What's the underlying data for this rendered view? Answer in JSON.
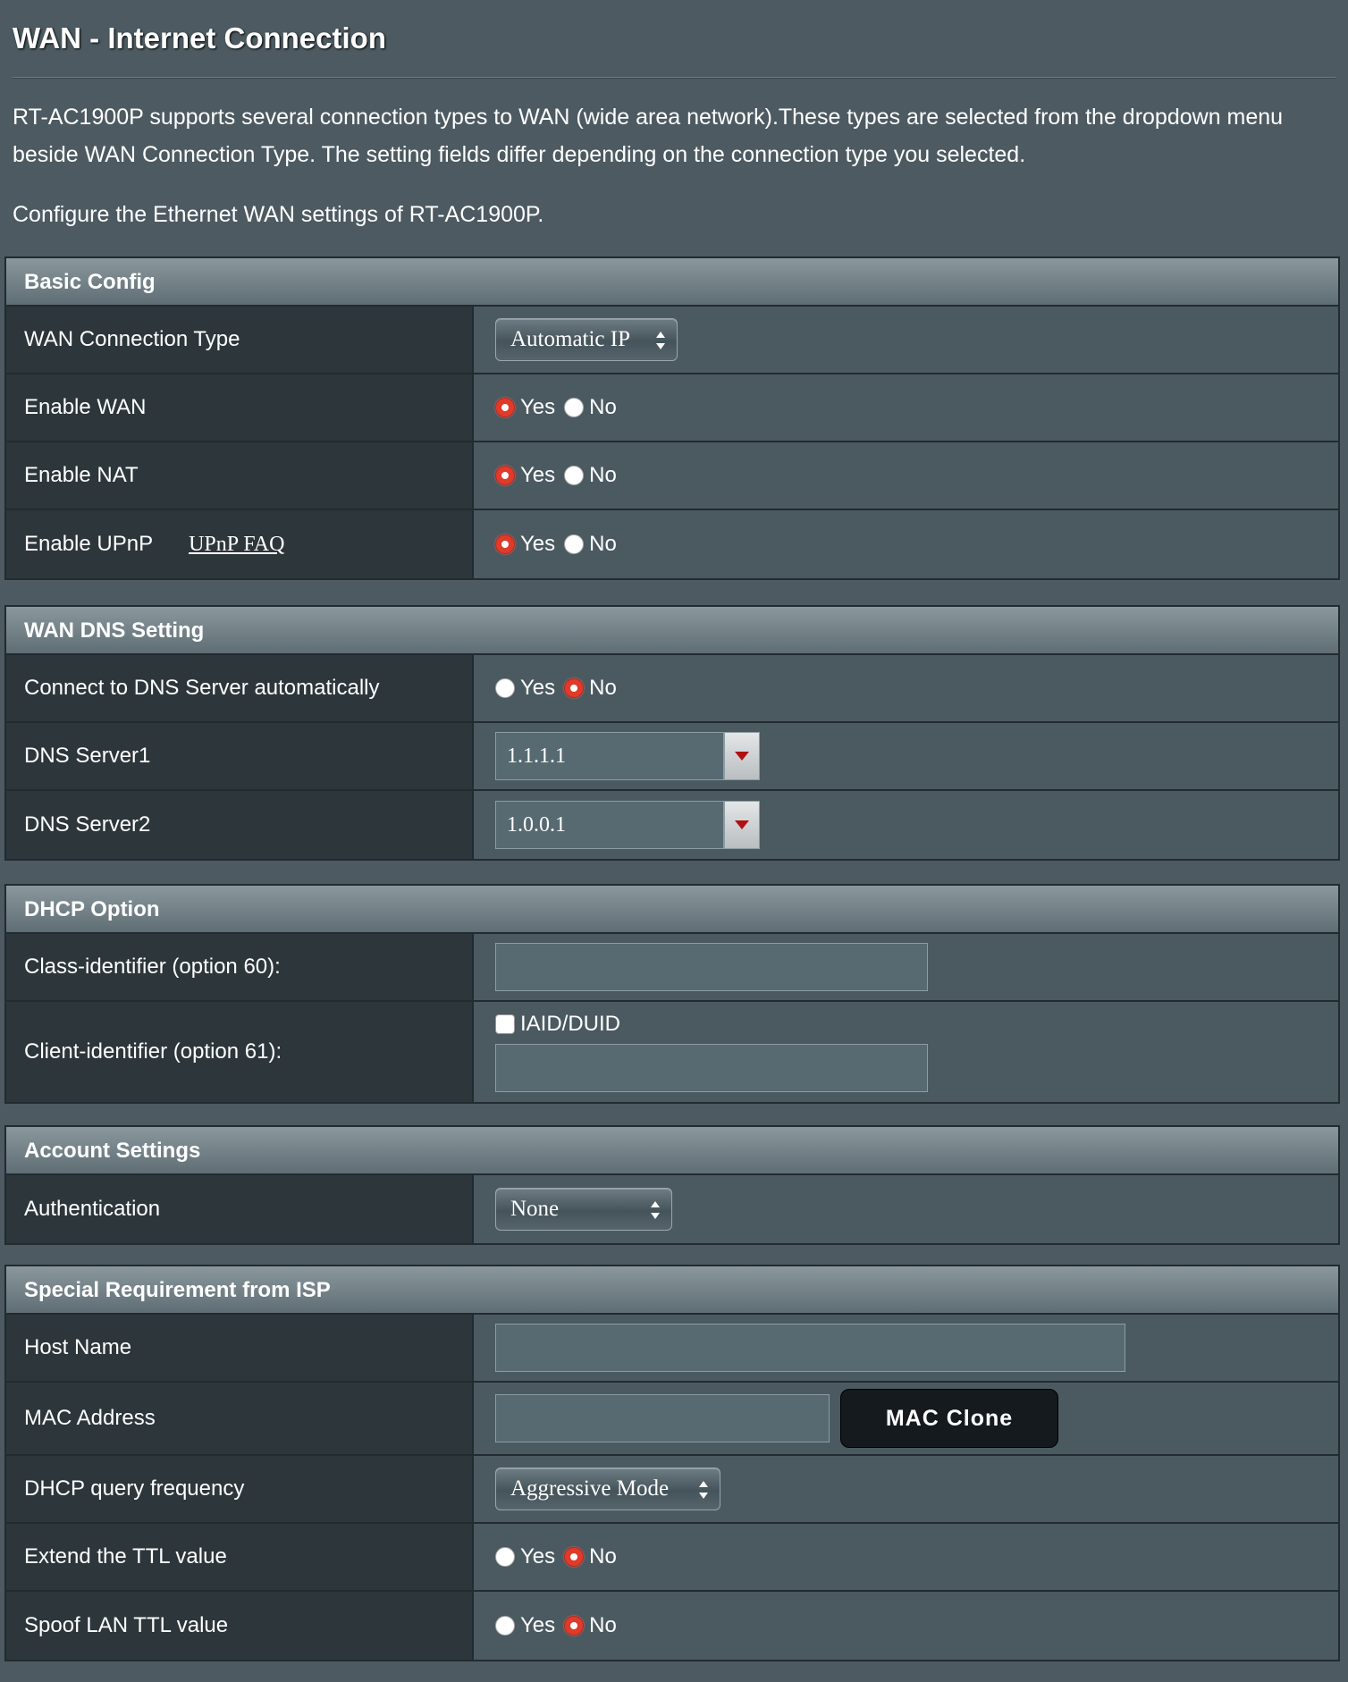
{
  "page": {
    "title": "WAN - Internet Connection",
    "description": "RT-AC1900P supports several connection types to WAN (wide area network).These types are selected from the dropdown menu beside WAN Connection Type. The setting fields differ depending on the connection type you selected.",
    "subdescription": "Configure the Ethernet WAN settings of RT-AC1900P."
  },
  "radio_labels": {
    "yes": "Yes",
    "no": "No"
  },
  "basic_config": {
    "header": "Basic Config",
    "wan_type_label": "WAN Connection Type",
    "wan_type_value": "Automatic IP",
    "enable_wan_label": "Enable WAN",
    "enable_wan_value": "Yes",
    "enable_nat_label": "Enable NAT",
    "enable_nat_value": "Yes",
    "enable_upnp_label": "Enable UPnP",
    "upnp_faq_link": "UPnP FAQ",
    "enable_upnp_value": "Yes"
  },
  "wan_dns": {
    "header": "WAN DNS Setting",
    "auto_dns_label": "Connect to DNS Server automatically",
    "auto_dns_value": "No",
    "dns1_label": "DNS Server1",
    "dns1_value": "1.1.1.1",
    "dns2_label": "DNS Server2",
    "dns2_value": "1.0.0.1"
  },
  "dhcp_option": {
    "header": "DHCP Option",
    "class_id_label": "Class-identifier (option 60):",
    "class_id_value": "",
    "client_id_label": "Client-identifier (option 61):",
    "iaid_duid_label": "IAID/DUID",
    "iaid_duid_checked": false,
    "client_id_value": ""
  },
  "account_settings": {
    "header": "Account Settings",
    "auth_label": "Authentication",
    "auth_value": "None"
  },
  "isp_requirement": {
    "header": "Special Requirement from ISP",
    "host_name_label": "Host Name",
    "host_name_value": "",
    "mac_label": "MAC Address",
    "mac_value": "",
    "mac_clone_button": "MAC Clone",
    "dhcp_freq_label": "DHCP query frequency",
    "dhcp_freq_value": "Aggressive Mode",
    "extend_ttl_label": "Extend the TTL value",
    "extend_ttl_value": "No",
    "spoof_ttl_label": "Spoof LAN TTL value",
    "spoof_ttl_value": "No"
  },
  "colors": {
    "background": "#4d5a61",
    "label_cell": "#2d363b",
    "value_cell": "#4b5a61",
    "radio_checked": "#e03b2a",
    "combo_arrow": "#b01010"
  }
}
